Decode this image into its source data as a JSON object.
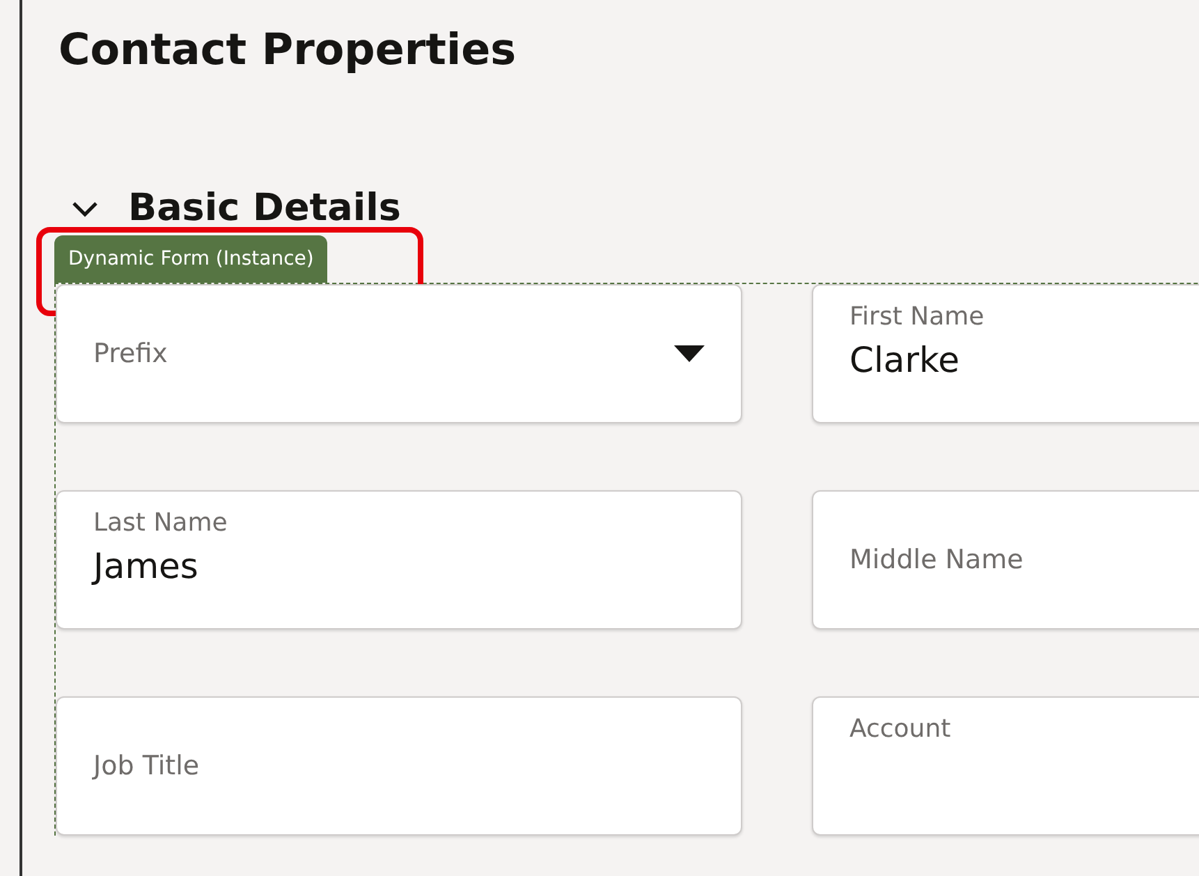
{
  "title": "Contact Properties",
  "section": {
    "label": "Basic Details",
    "expanded": true
  },
  "form_tag": "Dynamic Form (Instance)",
  "fields": [
    {
      "kind": "select",
      "label": "Prefix"
    },
    {
      "kind": "filled",
      "label": "First Name",
      "value": "Clarke"
    },
    {
      "kind": "filled",
      "label": "Last Name",
      "value": "James"
    },
    {
      "kind": "empty",
      "label": "Middle Name"
    },
    {
      "kind": "empty",
      "label": "Job Title"
    },
    {
      "kind": "filled",
      "label": "Account"
    }
  ]
}
